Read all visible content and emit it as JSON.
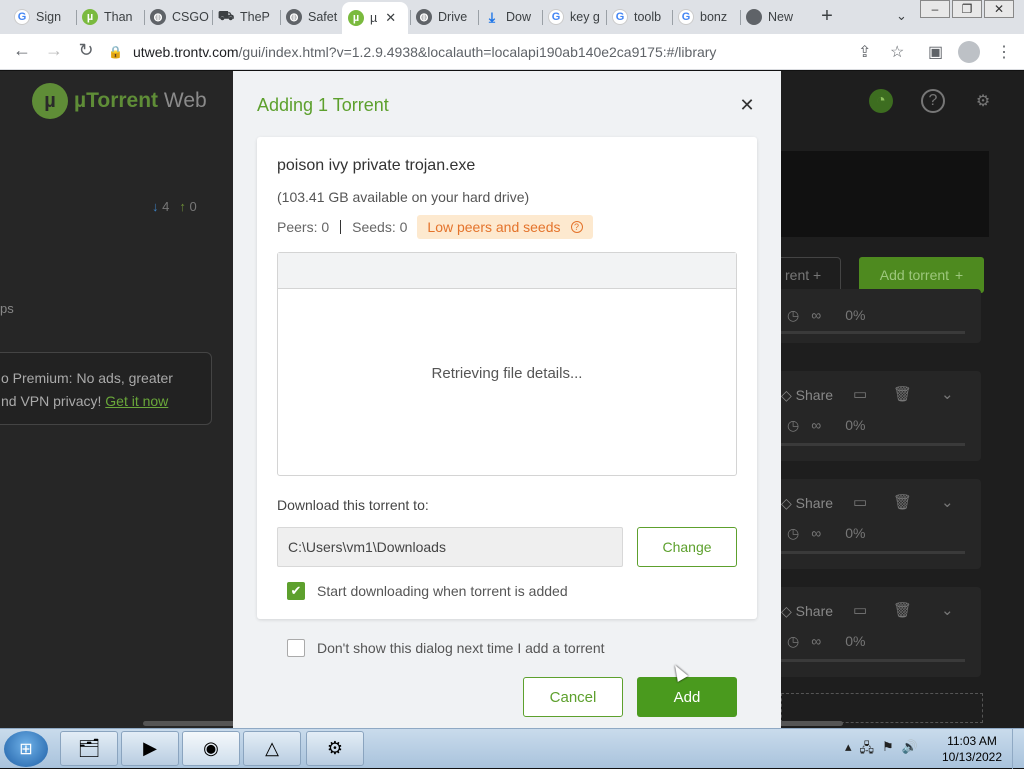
{
  "browser": {
    "tabs": [
      {
        "label": "Sign",
        "favicon": "google-icon"
      },
      {
        "label": "Than",
        "favicon": "utorrent-icon"
      },
      {
        "label": "CSGO",
        "favicon": "globe-icon"
      },
      {
        "label": "TheP",
        "favicon": "car-icon"
      },
      {
        "label": "Safet",
        "favicon": "globe-icon"
      },
      {
        "label": "µ",
        "favicon": "utorrent-icon",
        "active": true
      },
      {
        "label": "Drive",
        "favicon": "globe-icon"
      },
      {
        "label": "Dow",
        "favicon": "download-icon"
      },
      {
        "label": "key g",
        "favicon": "google-icon"
      },
      {
        "label": "toolb",
        "favicon": "google-icon"
      },
      {
        "label": "bonz",
        "favicon": "google-icon"
      },
      {
        "label": "New",
        "favicon": "chrome-icon"
      }
    ],
    "url_host": "utweb.trontv.com",
    "url_rest": "/gui/index.html?v=1.2.9.4938&localauth=localapi190ab140e2ca9175:#/library"
  },
  "app": {
    "logo_main": "µTorrent",
    "logo_web": "Web",
    "stats_down": "4",
    "stats_up": "0",
    "side_partial": "ps",
    "promo_line1": "o Premium: No ads, greater",
    "promo_line2": "nd VPN privacy!",
    "promo_link": "Get it now",
    "btn_remove_partial": "rent",
    "btn_add_torrent": "Add torrent",
    "rows": [
      {
        "share": "",
        "percent": "0%"
      },
      {
        "share": "Share",
        "percent": "0%"
      },
      {
        "share": "Share",
        "percent": "0%"
      },
      {
        "share": "Share",
        "percent": "0%"
      }
    ]
  },
  "dialog": {
    "title": "Adding 1 Torrent",
    "torrent_name": "poison ivy private trojan.exe",
    "available": "(103.41 GB available on your hard drive)",
    "peers": "Peers: 0",
    "seeds": "Seeds: 0",
    "warning": "Low peers and seeds",
    "files_status": "Retrieving file details...",
    "download_label": "Download this torrent to:",
    "download_path": "C:\\Users\\vm1\\Downloads",
    "change_label": "Change",
    "start_label": "Start downloading when torrent is added",
    "start_checked": true,
    "dont_show_label": "Don't show this dialog next time I add a torrent",
    "dont_show_checked": false,
    "cancel_label": "Cancel",
    "add_label": "Add",
    "accent_color": "#5da02d",
    "warning_color": "#e4732b"
  },
  "taskbar": {
    "items": [
      "explorer",
      "media-player",
      "chrome",
      "installer",
      "settings-gear"
    ],
    "time": "11:03 AM",
    "date": "10/13/2022"
  }
}
